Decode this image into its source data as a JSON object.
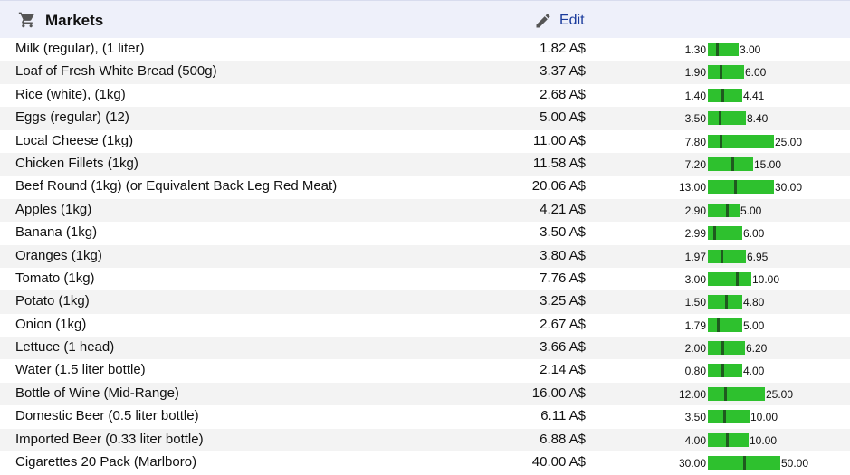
{
  "header": {
    "title": "Markets",
    "cart_icon": "shopping-cart-icon",
    "edit_label": "Edit",
    "edit_icon": "pencil-icon"
  },
  "colors": {
    "bar": "#2ec12e",
    "marker": "#1f5a1f",
    "header_bg": "#eef0fa",
    "link": "#1a3b9c"
  },
  "rows": [
    {
      "item": "Milk (regular), (1 liter)",
      "price": "1.82 A$",
      "min": "1.30",
      "max": "3.00"
    },
    {
      "item": "Loaf of Fresh White Bread (500g)",
      "price": "3.37 A$",
      "min": "1.90",
      "max": "6.00"
    },
    {
      "item": "Rice (white), (1kg)",
      "price": "2.68 A$",
      "min": "1.40",
      "max": "4.41"
    },
    {
      "item": "Eggs (regular) (12)",
      "price": "5.00 A$",
      "min": "3.50",
      "max": "8.40"
    },
    {
      "item": "Local Cheese (1kg)",
      "price": "11.00 A$",
      "min": "7.80",
      "max": "25.00"
    },
    {
      "item": "Chicken Fillets (1kg)",
      "price": "11.58 A$",
      "min": "7.20",
      "max": "15.00"
    },
    {
      "item": "Beef Round (1kg) (or Equivalent Back Leg Red Meat)",
      "price": "20.06 A$",
      "min": "13.00",
      "max": "30.00"
    },
    {
      "item": "Apples (1kg)",
      "price": "4.21 A$",
      "min": "2.90",
      "max": "5.00"
    },
    {
      "item": "Banana (1kg)",
      "price": "3.50 A$",
      "min": "2.99",
      "max": "6.00"
    },
    {
      "item": "Oranges (1kg)",
      "price": "3.80 A$",
      "min": "1.97",
      "max": "6.95"
    },
    {
      "item": "Tomato (1kg)",
      "price": "7.76 A$",
      "min": "3.00",
      "max": "10.00"
    },
    {
      "item": "Potato (1kg)",
      "price": "3.25 A$",
      "min": "1.50",
      "max": "4.80"
    },
    {
      "item": "Onion (1kg)",
      "price": "2.67 A$",
      "min": "1.79",
      "max": "5.00"
    },
    {
      "item": "Lettuce (1 head)",
      "price": "3.66 A$",
      "min": "2.00",
      "max": "6.20"
    },
    {
      "item": "Water (1.5 liter bottle)",
      "price": "2.14 A$",
      "min": "0.80",
      "max": "4.00"
    },
    {
      "item": "Bottle of Wine (Mid-Range)",
      "price": "16.00 A$",
      "min": "12.00",
      "max": "25.00"
    },
    {
      "item": "Domestic Beer (0.5 liter bottle)",
      "price": "6.11 A$",
      "min": "3.50",
      "max": "10.00"
    },
    {
      "item": "Imported Beer (0.33 liter bottle)",
      "price": "6.88 A$",
      "min": "4.00",
      "max": "10.00"
    },
    {
      "item": "Cigarettes 20 Pack (Marlboro)",
      "price": "40.00 A$",
      "min": "30.00",
      "max": "50.00"
    }
  ]
}
